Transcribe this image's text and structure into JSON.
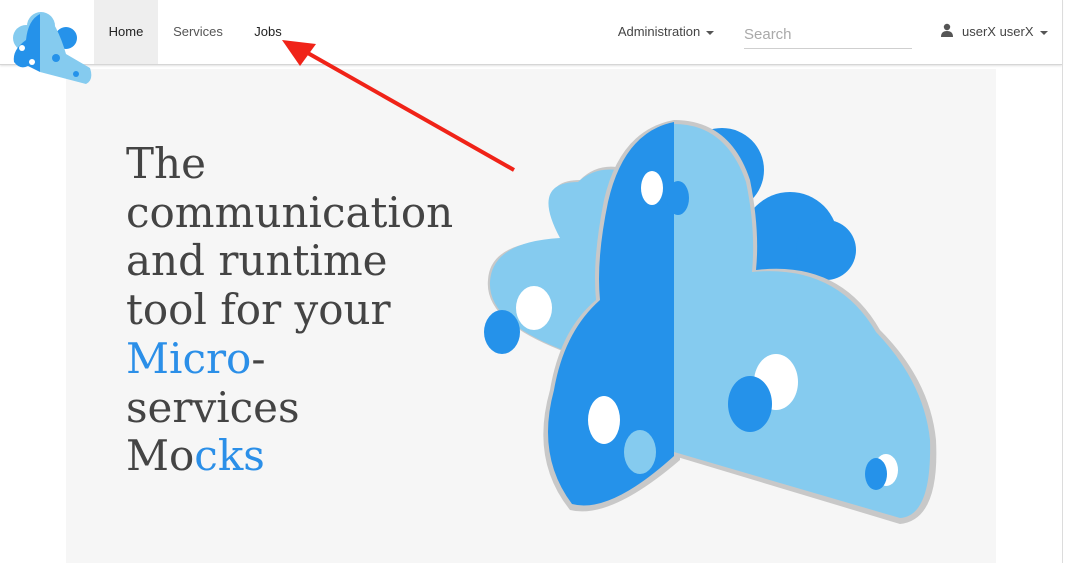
{
  "nav": {
    "home": "Home",
    "services": "Services",
    "jobs": "Jobs",
    "administration": "Administration",
    "search_placeholder": "Search",
    "user": "userX userX"
  },
  "hero": {
    "line1": "The",
    "line2": "communication",
    "line3": "and runtime",
    "line4": "tool for your",
    "line5_accent": "Micro",
    "line5_rest": "-",
    "line6": "services",
    "line7_plain": "Mo",
    "line7_accent": "cks"
  },
  "colors": {
    "accent": "#2b8fe8",
    "logo_light": "#85cbef",
    "logo_dark": "#2592ea",
    "annotation_arrow": "#f02318"
  },
  "icons": {
    "logo": "microcks-cloud-logo",
    "user": "user-icon",
    "caret": "caret-down-icon",
    "annotation": "red-arrow"
  }
}
